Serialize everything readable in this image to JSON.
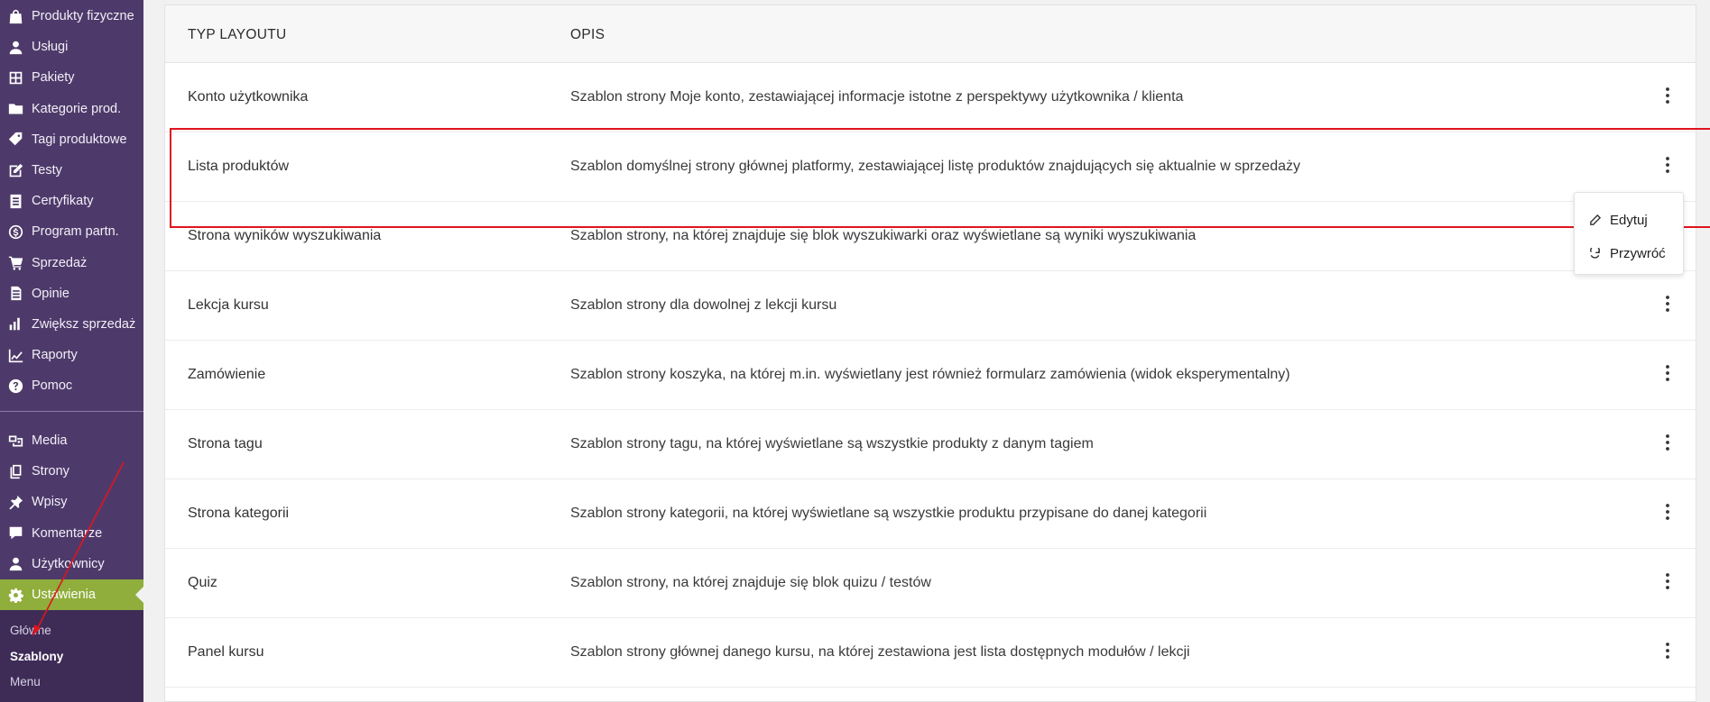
{
  "sidebar": {
    "group1": [
      {
        "label": "Produkty fizyczne",
        "icon": "bag-icon"
      },
      {
        "label": "Usługi",
        "icon": "user-icon"
      },
      {
        "label": "Pakiety",
        "icon": "grid-icon"
      },
      {
        "label": "Kategorie prod.",
        "icon": "folder-icon"
      },
      {
        "label": "Tagi produktowe",
        "icon": "tag-icon"
      },
      {
        "label": "Testy",
        "icon": "edit-icon"
      },
      {
        "label": "Certyfikaty",
        "icon": "document-icon"
      },
      {
        "label": "Program partn.",
        "icon": "dollar-icon"
      },
      {
        "label": "Sprzedaż",
        "icon": "cart-icon"
      },
      {
        "label": "Opinie",
        "icon": "page-icon"
      },
      {
        "label": "Zwiększ sprzedaż",
        "icon": "bar-chart-icon"
      },
      {
        "label": "Raporty",
        "icon": "line-chart-icon"
      },
      {
        "label": "Pomoc",
        "icon": "help-icon"
      }
    ],
    "group2": [
      {
        "label": "Media",
        "icon": "media-icon"
      },
      {
        "label": "Strony",
        "icon": "pages-icon"
      },
      {
        "label": "Wpisy",
        "icon": "pin-icon"
      },
      {
        "label": "Komentarze",
        "icon": "comment-icon"
      },
      {
        "label": "Użytkownicy",
        "icon": "users-icon"
      },
      {
        "label": "Ustawienia",
        "icon": "settings-icon",
        "active": true
      }
    ],
    "submenu": [
      "Główne",
      "Szablony",
      "Menu"
    ],
    "current_submenu": "Szablony"
  },
  "table": {
    "headers": {
      "type": "TYP LAYOUTU",
      "desc": "OPIS"
    },
    "rows": [
      {
        "type": "Konto użytkownika",
        "desc": "Szablon strony Moje konto, zestawiającej informacje istotne z perspektywy użytkownika / klienta"
      },
      {
        "type": "Lista produktów",
        "desc": "Szablon domyślnej strony głównej platformy, zestawiającej listę produktów znajdujących się aktualnie w sprzedaży"
      },
      {
        "type": "Strona wyników wyszukiwania",
        "desc": "Szablon strony, na której znajduje się blok wyszukiwarki oraz wyświetlane są wyniki wyszukiwania"
      },
      {
        "type": "Lekcja kursu",
        "desc": "Szablon strony dla dowolnej z lekcji kursu"
      },
      {
        "type": "Zamówienie",
        "desc": "Szablon strony koszyka, na której m.in. wyświetlany jest również formularz zamówienia (widok eksperymentalny)"
      },
      {
        "type": "Strona tagu",
        "desc": "Szablon strony tagu, na której wyświetlane są wszystkie produkty z danym tagiem"
      },
      {
        "type": "Strona kategorii",
        "desc": "Szablon strony kategorii, na której wyświetlane są wszystkie produktu przypisane do danej kategorii"
      },
      {
        "type": "Quiz",
        "desc": "Szablon strony, na której znajduje się blok quizu / testów"
      },
      {
        "type": "Panel kursu",
        "desc": "Szablon strony głównej danego kursu, na której zestawiona jest lista dostępnych modułów / lekcji"
      }
    ]
  },
  "dropdown": {
    "items": [
      {
        "label": "Edytuj",
        "icon": "pencil-icon"
      },
      {
        "label": "Przywróć",
        "icon": "restore-icon"
      }
    ]
  },
  "colors": {
    "sidebar_bg": "#4e3a6a",
    "active_bg": "#8fae3b",
    "highlight": "#e0141f"
  }
}
